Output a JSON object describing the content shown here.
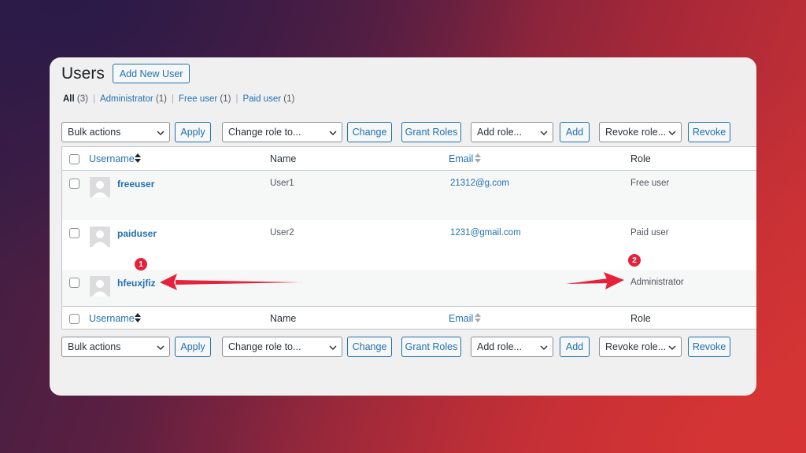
{
  "header": {
    "title": "Users",
    "add_new_label": "Add New User"
  },
  "filters": {
    "all": "All",
    "all_count": "(3)",
    "administrator": "Administrator",
    "administrator_count": "(1)",
    "free_user": "Free user",
    "free_user_count": "(1)",
    "paid_user": "Paid user",
    "paid_user_count": "(1)",
    "separator": "|"
  },
  "toolbar": {
    "bulk_actions": "Bulk actions",
    "apply": "Apply",
    "change_role": "Change role to...",
    "change": "Change",
    "grant_roles": "Grant Roles",
    "add_role": "Add role...",
    "add": "Add",
    "revoke_role": "Revoke role...",
    "revoke": "Revoke"
  },
  "table": {
    "columns": {
      "username": "Username",
      "name": "Name",
      "email": "Email",
      "role": "Role"
    },
    "rows": [
      {
        "username": "freeuser",
        "name": "User1",
        "email": "21312@g.com",
        "role": "Free user"
      },
      {
        "username": "paiduser",
        "name": "User2",
        "email": "1231@gmail.com",
        "role": "Paid user"
      },
      {
        "username": "hfeuxjfiz",
        "name": "",
        "email": "",
        "role": "Administrator"
      }
    ]
  },
  "annotations": {
    "badge_1": "1",
    "badge_2": "2",
    "color": "#e5223c"
  },
  "colors": {
    "link": "#2271b1",
    "panel": "#f0f0f1"
  }
}
